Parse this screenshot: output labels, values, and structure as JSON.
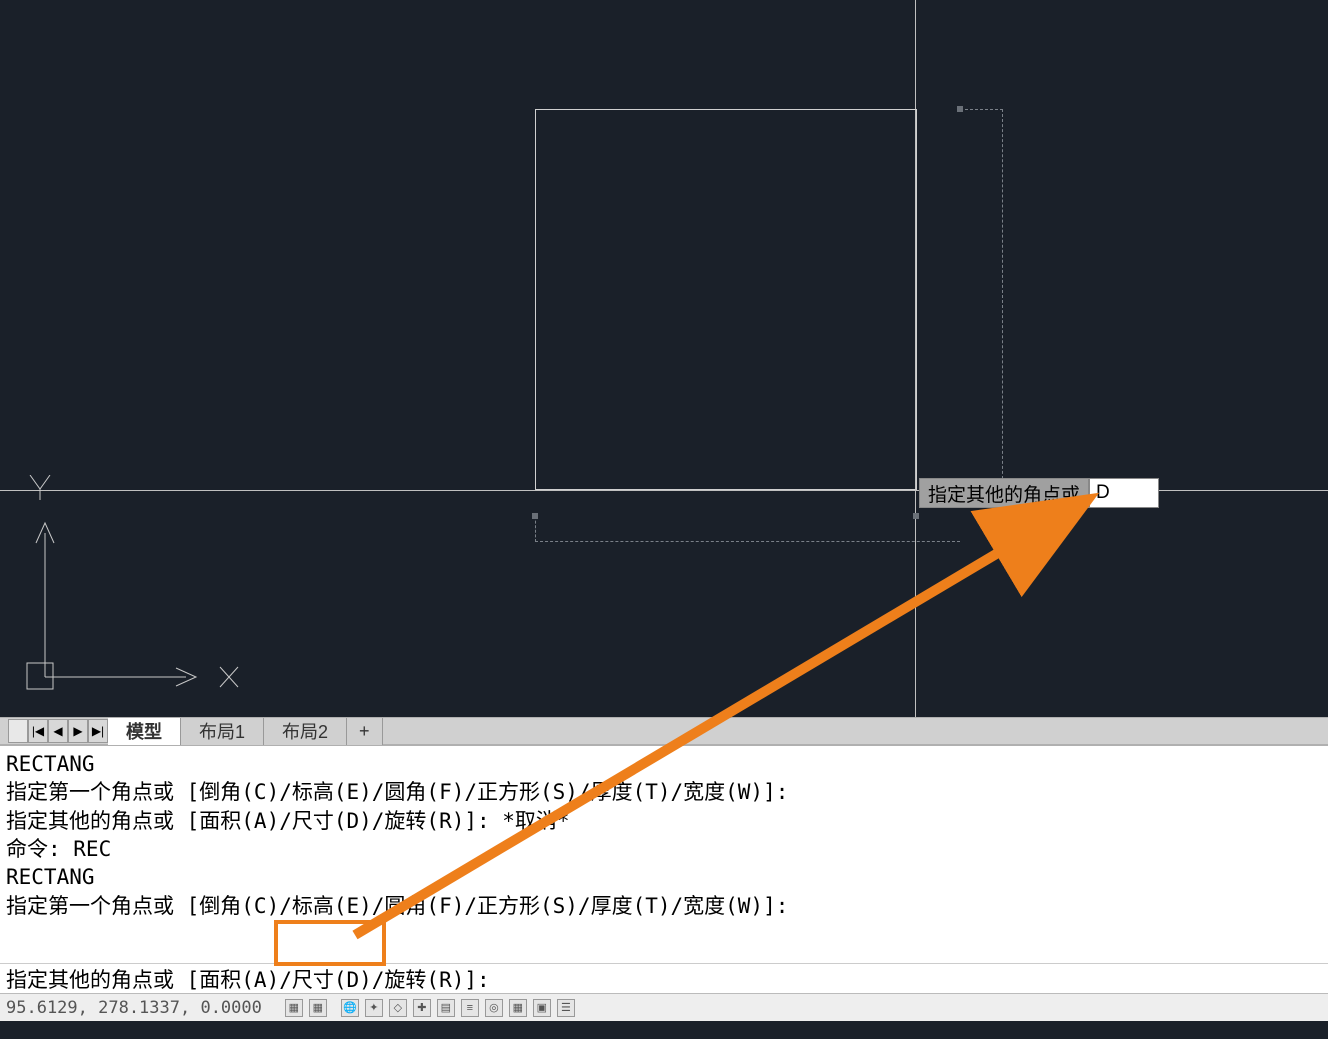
{
  "canvas": {
    "dynprompt_label": "指定其他的角点或",
    "dynprompt_value": "D"
  },
  "ucs": {
    "x_label": "X",
    "y_label": "Y"
  },
  "tabs": {
    "model": "模型",
    "layout1": "布局1",
    "layout2": "布局2",
    "add": "+"
  },
  "cmd_history": [
    "RECTANG",
    "指定第一个角点或 [倒角(C)/标高(E)/圆角(F)/正方形(S)/厚度(T)/宽度(W)]:",
    "指定其他的角点或 [面积(A)/尺寸(D)/旋转(R)]: *取消*",
    "命令: REC",
    "RECTANG",
    "指定第一个角点或 [倒角(C)/标高(E)/圆角(F)/正方形(S)/厚度(T)/宽度(W)]:"
  ],
  "cmd_input": "指定其他的角点或 [面积(A)/尺寸(D)/旋转(R)]:",
  "status": {
    "coords": "95.6129, 278.1337, 0.0000"
  }
}
